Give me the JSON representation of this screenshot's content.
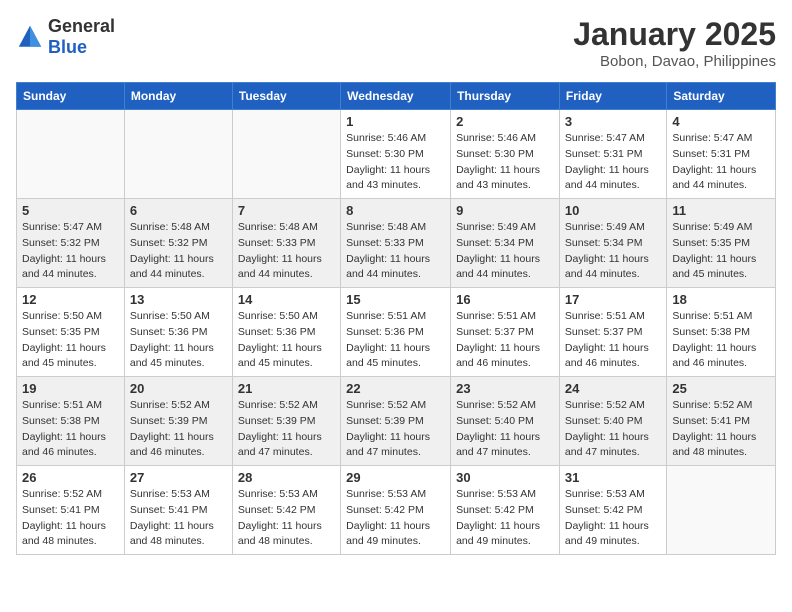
{
  "header": {
    "logo_general": "General",
    "logo_blue": "Blue",
    "month_year": "January 2025",
    "location": "Bobon, Davao, Philippines"
  },
  "days_of_week": [
    "Sunday",
    "Monday",
    "Tuesday",
    "Wednesday",
    "Thursday",
    "Friday",
    "Saturday"
  ],
  "weeks": [
    [
      {
        "day": "",
        "info": ""
      },
      {
        "day": "",
        "info": ""
      },
      {
        "day": "",
        "info": ""
      },
      {
        "day": "1",
        "info": "Sunrise: 5:46 AM\nSunset: 5:30 PM\nDaylight: 11 hours\nand 43 minutes."
      },
      {
        "day": "2",
        "info": "Sunrise: 5:46 AM\nSunset: 5:30 PM\nDaylight: 11 hours\nand 43 minutes."
      },
      {
        "day": "3",
        "info": "Sunrise: 5:47 AM\nSunset: 5:31 PM\nDaylight: 11 hours\nand 44 minutes."
      },
      {
        "day": "4",
        "info": "Sunrise: 5:47 AM\nSunset: 5:31 PM\nDaylight: 11 hours\nand 44 minutes."
      }
    ],
    [
      {
        "day": "5",
        "info": "Sunrise: 5:47 AM\nSunset: 5:32 PM\nDaylight: 11 hours\nand 44 minutes."
      },
      {
        "day": "6",
        "info": "Sunrise: 5:48 AM\nSunset: 5:32 PM\nDaylight: 11 hours\nand 44 minutes."
      },
      {
        "day": "7",
        "info": "Sunrise: 5:48 AM\nSunset: 5:33 PM\nDaylight: 11 hours\nand 44 minutes."
      },
      {
        "day": "8",
        "info": "Sunrise: 5:48 AM\nSunset: 5:33 PM\nDaylight: 11 hours\nand 44 minutes."
      },
      {
        "day": "9",
        "info": "Sunrise: 5:49 AM\nSunset: 5:34 PM\nDaylight: 11 hours\nand 44 minutes."
      },
      {
        "day": "10",
        "info": "Sunrise: 5:49 AM\nSunset: 5:34 PM\nDaylight: 11 hours\nand 44 minutes."
      },
      {
        "day": "11",
        "info": "Sunrise: 5:49 AM\nSunset: 5:35 PM\nDaylight: 11 hours\nand 45 minutes."
      }
    ],
    [
      {
        "day": "12",
        "info": "Sunrise: 5:50 AM\nSunset: 5:35 PM\nDaylight: 11 hours\nand 45 minutes."
      },
      {
        "day": "13",
        "info": "Sunrise: 5:50 AM\nSunset: 5:36 PM\nDaylight: 11 hours\nand 45 minutes."
      },
      {
        "day": "14",
        "info": "Sunrise: 5:50 AM\nSunset: 5:36 PM\nDaylight: 11 hours\nand 45 minutes."
      },
      {
        "day": "15",
        "info": "Sunrise: 5:51 AM\nSunset: 5:36 PM\nDaylight: 11 hours\nand 45 minutes."
      },
      {
        "day": "16",
        "info": "Sunrise: 5:51 AM\nSunset: 5:37 PM\nDaylight: 11 hours\nand 46 minutes."
      },
      {
        "day": "17",
        "info": "Sunrise: 5:51 AM\nSunset: 5:37 PM\nDaylight: 11 hours\nand 46 minutes."
      },
      {
        "day": "18",
        "info": "Sunrise: 5:51 AM\nSunset: 5:38 PM\nDaylight: 11 hours\nand 46 minutes."
      }
    ],
    [
      {
        "day": "19",
        "info": "Sunrise: 5:51 AM\nSunset: 5:38 PM\nDaylight: 11 hours\nand 46 minutes."
      },
      {
        "day": "20",
        "info": "Sunrise: 5:52 AM\nSunset: 5:39 PM\nDaylight: 11 hours\nand 46 minutes."
      },
      {
        "day": "21",
        "info": "Sunrise: 5:52 AM\nSunset: 5:39 PM\nDaylight: 11 hours\nand 47 minutes."
      },
      {
        "day": "22",
        "info": "Sunrise: 5:52 AM\nSunset: 5:39 PM\nDaylight: 11 hours\nand 47 minutes."
      },
      {
        "day": "23",
        "info": "Sunrise: 5:52 AM\nSunset: 5:40 PM\nDaylight: 11 hours\nand 47 minutes."
      },
      {
        "day": "24",
        "info": "Sunrise: 5:52 AM\nSunset: 5:40 PM\nDaylight: 11 hours\nand 47 minutes."
      },
      {
        "day": "25",
        "info": "Sunrise: 5:52 AM\nSunset: 5:41 PM\nDaylight: 11 hours\nand 48 minutes."
      }
    ],
    [
      {
        "day": "26",
        "info": "Sunrise: 5:52 AM\nSunset: 5:41 PM\nDaylight: 11 hours\nand 48 minutes."
      },
      {
        "day": "27",
        "info": "Sunrise: 5:53 AM\nSunset: 5:41 PM\nDaylight: 11 hours\nand 48 minutes."
      },
      {
        "day": "28",
        "info": "Sunrise: 5:53 AM\nSunset: 5:42 PM\nDaylight: 11 hours\nand 48 minutes."
      },
      {
        "day": "29",
        "info": "Sunrise: 5:53 AM\nSunset: 5:42 PM\nDaylight: 11 hours\nand 49 minutes."
      },
      {
        "day": "30",
        "info": "Sunrise: 5:53 AM\nSunset: 5:42 PM\nDaylight: 11 hours\nand 49 minutes."
      },
      {
        "day": "31",
        "info": "Sunrise: 5:53 AM\nSunset: 5:42 PM\nDaylight: 11 hours\nand 49 minutes."
      },
      {
        "day": "",
        "info": ""
      }
    ]
  ]
}
